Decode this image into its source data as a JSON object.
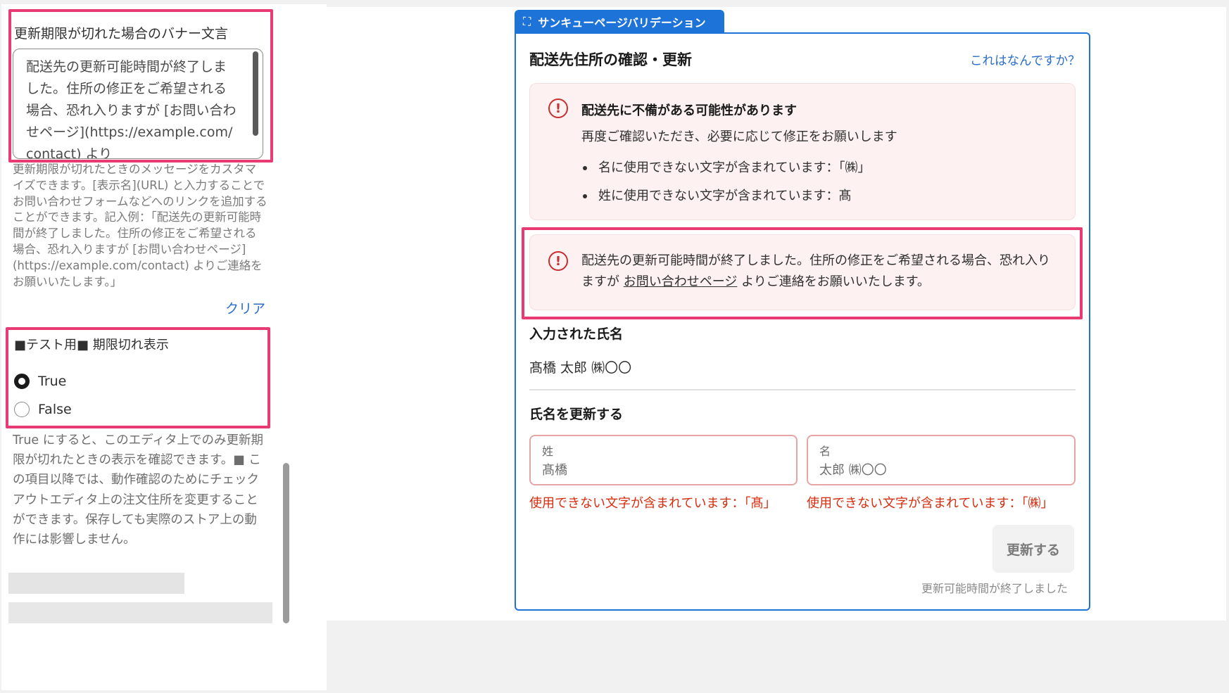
{
  "settings": {
    "banner_field_label": "更新期限が切れた場合のバナー文言",
    "banner_field_value": "配送先の更新可能時間が終了しました。住所の修正をご希望される場合、恐れ入りますが [お問い合わせページ](https://example.com/contact) より",
    "banner_help_text": "更新期限が切れたときのメッセージをカスタマイズできます。[表示名](URL) と入力することでお問い合わせフォームなどへのリンクを追加することができます。記入例：「配送先の更新可能時間が終了しました。住所の修正をご希望される場合、恐れ入りますが [お問い合わせページ](https://example.com/contact) よりご連絡をお願いいたします。」",
    "clear_label": "クリア",
    "test_field_label": "■テスト用■ 期限切れ表示",
    "radio_options": [
      {
        "label": "True",
        "checked": true
      },
      {
        "label": "False",
        "checked": false
      }
    ],
    "test_help_text": "True にすると、このエディタ上でのみ更新期限が切れたときの表示を確認できます。■ この項目以降では、動作確認のためにチェックアウトエディタ上の注文住所を変更することができます。保存しても実際のストア上の動作には影響しません。"
  },
  "preview": {
    "tag_label": "サンキューページバリデーション",
    "tag_icon": "expand-icon",
    "card_title": "配送先住所の確認・更新",
    "help_link": "これはなんですか？",
    "warning_banner": {
      "title": "配送先に不備がある可能性があります",
      "description": "再度ご確認いただき、必要に応じて修正をお願いします",
      "items": [
        "名に使用できない文字が含まれています：「㈱」",
        "姓に使用できない文字が含まれています：髙"
      ]
    },
    "expired_banner": {
      "text_before": "配送先の更新可能時間が終了しました。住所の修正をご希望される場合、恐れ入りますが ",
      "link_text": "お問い合わせページ",
      "text_after": " よりご連絡をお願いいたします。"
    },
    "entered_name_heading": "入力された氏名",
    "entered_name_value": "髙橋 太郎 ㈱〇〇",
    "update_name_heading": "氏名を更新する",
    "last_name": {
      "label": "姓",
      "value": "髙橋",
      "error": "使用できない文字が含まれています：「髙」"
    },
    "first_name": {
      "label": "名",
      "value": "太郎 ㈱〇〇",
      "error": "使用できない文字が含まれています：「㈱」"
    },
    "update_button": "更新する",
    "expired_note": "更新可能時間が終了しました"
  },
  "colors": {
    "highlight": "#e83a73",
    "accent_blue": "#1e73d8",
    "error_red": "#d72c0d",
    "banner_bg": "#fdf1f1"
  }
}
